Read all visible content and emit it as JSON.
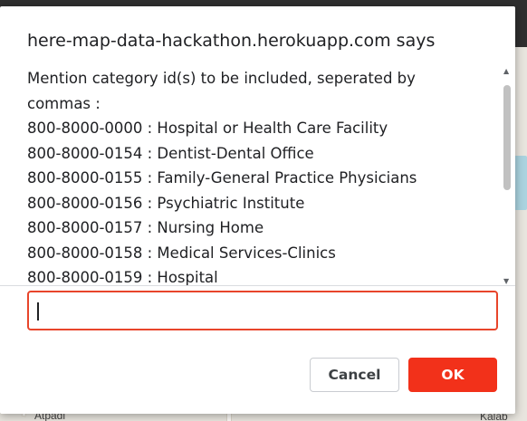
{
  "background": {
    "map_labels": [
      "Atpadi",
      "Kalab"
    ]
  },
  "dialog": {
    "title": "here-map-data-hackathon.herokuapp.com says",
    "message_lines": [
      "Mention category id(s) to be included, seperated by commas :",
      "800-8000-0000 : Hospital or Health Care Facility",
      "800-8000-0154 : Dentist-Dental Office",
      "800-8000-0155 : Family-General Practice Physicians",
      "800-8000-0156 : Psychiatric Institute",
      "800-8000-0157 : Nursing Home",
      "800-8000-0158 : Medical Services-Clinics",
      "800-8000-0159 : Hospital"
    ],
    "input": {
      "value": "",
      "placeholder": ""
    },
    "buttons": {
      "cancel_label": "Cancel",
      "ok_label": "OK"
    }
  },
  "colors": {
    "ok_button": "#f2311a",
    "input_focus_border": "#e8452b",
    "topbar": "#2f2f2f"
  }
}
